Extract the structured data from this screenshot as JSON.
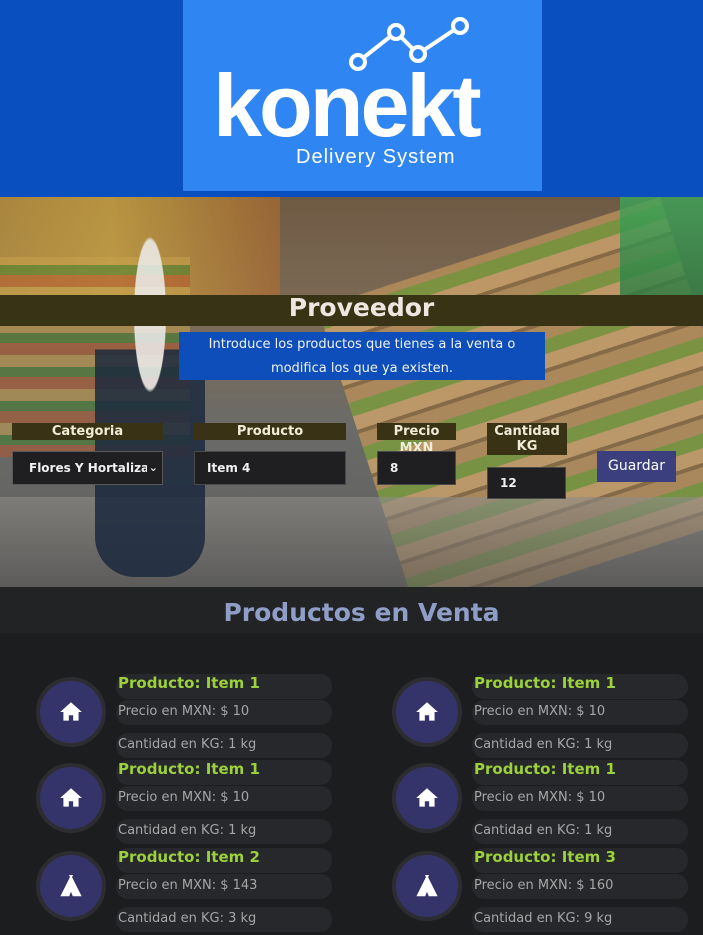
{
  "brand": {
    "logo_text": "konekt",
    "logo_subtitle": "Delivery System",
    "colors": {
      "topbar": "#0a4fc0",
      "logo_box": "#2f86f3"
    }
  },
  "supplier": {
    "title": "Proveedor",
    "intro": "Introduce los productos que tienes a la venta o modifica los que ya existen."
  },
  "form": {
    "category_label": "Categoria",
    "product_label": "Producto",
    "price_label": "Precio MXN",
    "quantity_label": "Cantidad KG",
    "category_value": "Flores Y Hortalizas",
    "product_value": "Item 4",
    "price_value": "8",
    "quantity_value": "12",
    "save_label": "Guardar"
  },
  "products_section": {
    "title": "Productos en Venta",
    "accent_color": "#9bd13a",
    "items": [
      {
        "icon": "home-icon",
        "name": "Producto: Item 1",
        "price": "Precio en MXN: $ 10",
        "quantity": "Cantidad en KG: 1 kg"
      },
      {
        "icon": "home-icon",
        "name": "Producto: Item 1",
        "price": "Precio en MXN: $ 10",
        "quantity": "Cantidad en KG: 1 kg"
      },
      {
        "icon": "home-icon",
        "name": "Producto: Item 1",
        "price": "Precio en MXN: $ 10",
        "quantity": "Cantidad en KG: 1 kg"
      },
      {
        "icon": "home-icon",
        "name": "Producto: Item 1",
        "price": "Precio en MXN: $ 10",
        "quantity": "Cantidad en KG: 1 kg"
      },
      {
        "icon": "tent-icon",
        "name": "Producto: Item 2",
        "price": "Precio en MXN: $ 143",
        "quantity": "Cantidad en KG: 3 kg"
      },
      {
        "icon": "tent-icon",
        "name": "Producto: Item 3",
        "price": "Precio en MXN: $ 160",
        "quantity": "Cantidad en KG: 9 kg"
      }
    ]
  }
}
